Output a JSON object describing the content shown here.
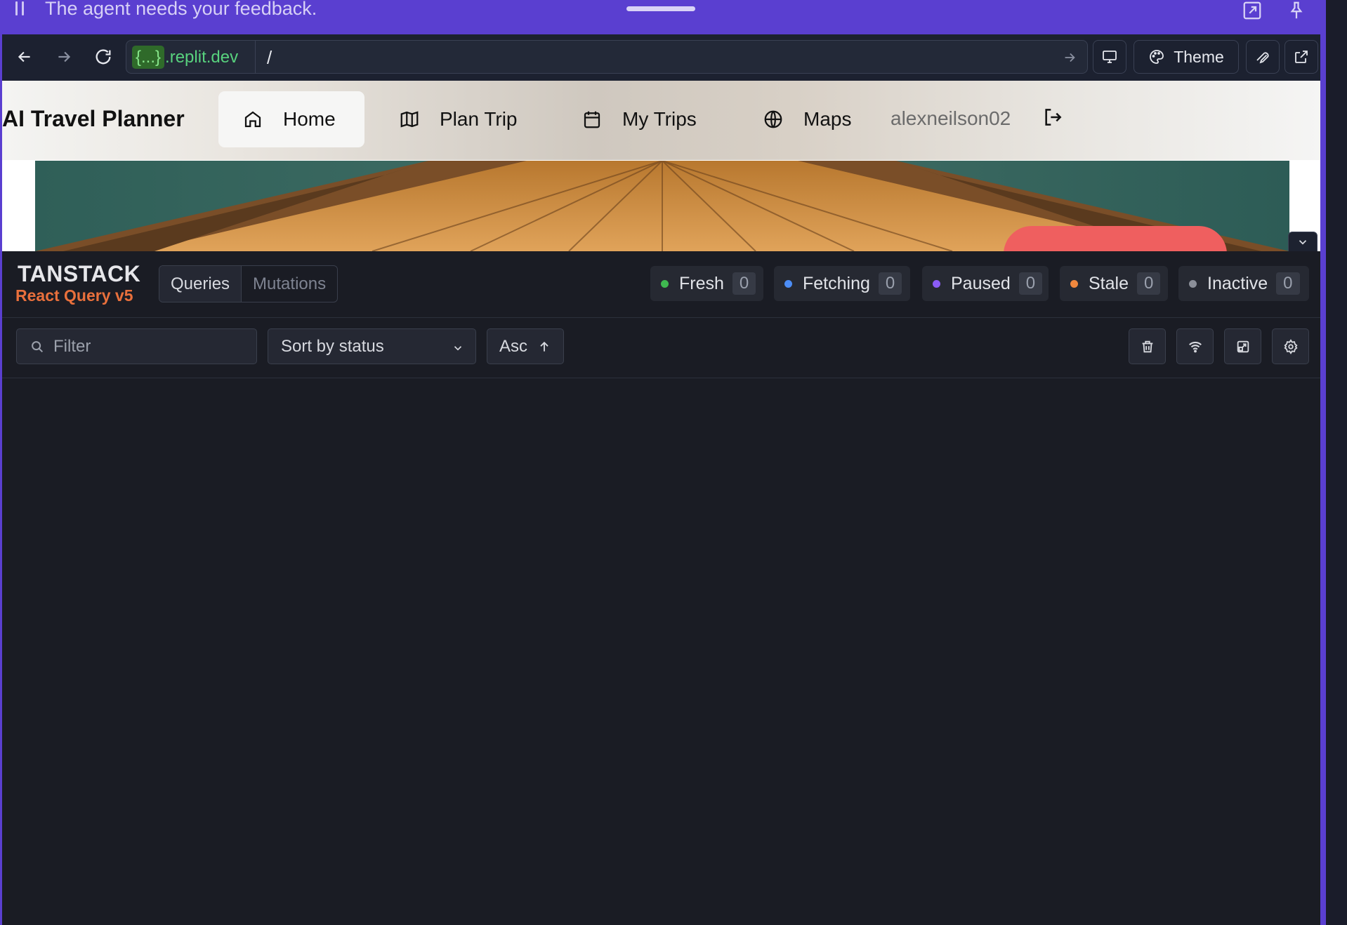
{
  "agent_bar": {
    "message": "The agent needs your feedback."
  },
  "browser": {
    "url_host_braces": "{...}",
    "url_host_domain": ".replit.dev",
    "url_path": "/",
    "theme_label": "Theme"
  },
  "app": {
    "title": "AI Travel Planner",
    "nav": [
      {
        "label": "Home",
        "icon": "home-icon",
        "active": true
      },
      {
        "label": "Plan Trip",
        "icon": "map-icon",
        "active": false
      },
      {
        "label": "My Trips",
        "icon": "calendar-icon",
        "active": false
      },
      {
        "label": "Maps",
        "icon": "globe-icon",
        "active": false
      }
    ],
    "username": "alexneilson02"
  },
  "devtools": {
    "brand_top": "TANSTACK",
    "brand_bottom": "React Query v5",
    "tabs": [
      {
        "label": "Queries",
        "active": true
      },
      {
        "label": "Mutations",
        "active": false
      }
    ],
    "statuses": [
      {
        "label": "Fresh",
        "count": "0",
        "color": "#3fb950"
      },
      {
        "label": "Fetching",
        "count": "0",
        "color": "#4c8df6"
      },
      {
        "label": "Paused",
        "count": "0",
        "color": "#8b5cf6"
      },
      {
        "label": "Stale",
        "count": "0",
        "color": "#f0883e"
      },
      {
        "label": "Inactive",
        "count": "0",
        "color": "#8b8f99"
      }
    ],
    "filter_placeholder": "Filter",
    "sort_value": "Sort by status",
    "order_label": "Asc"
  },
  "colors": {
    "agent_bar": "#5a3fd0",
    "cta": "#ef5f5f",
    "brand_orange": "#e9703c"
  }
}
